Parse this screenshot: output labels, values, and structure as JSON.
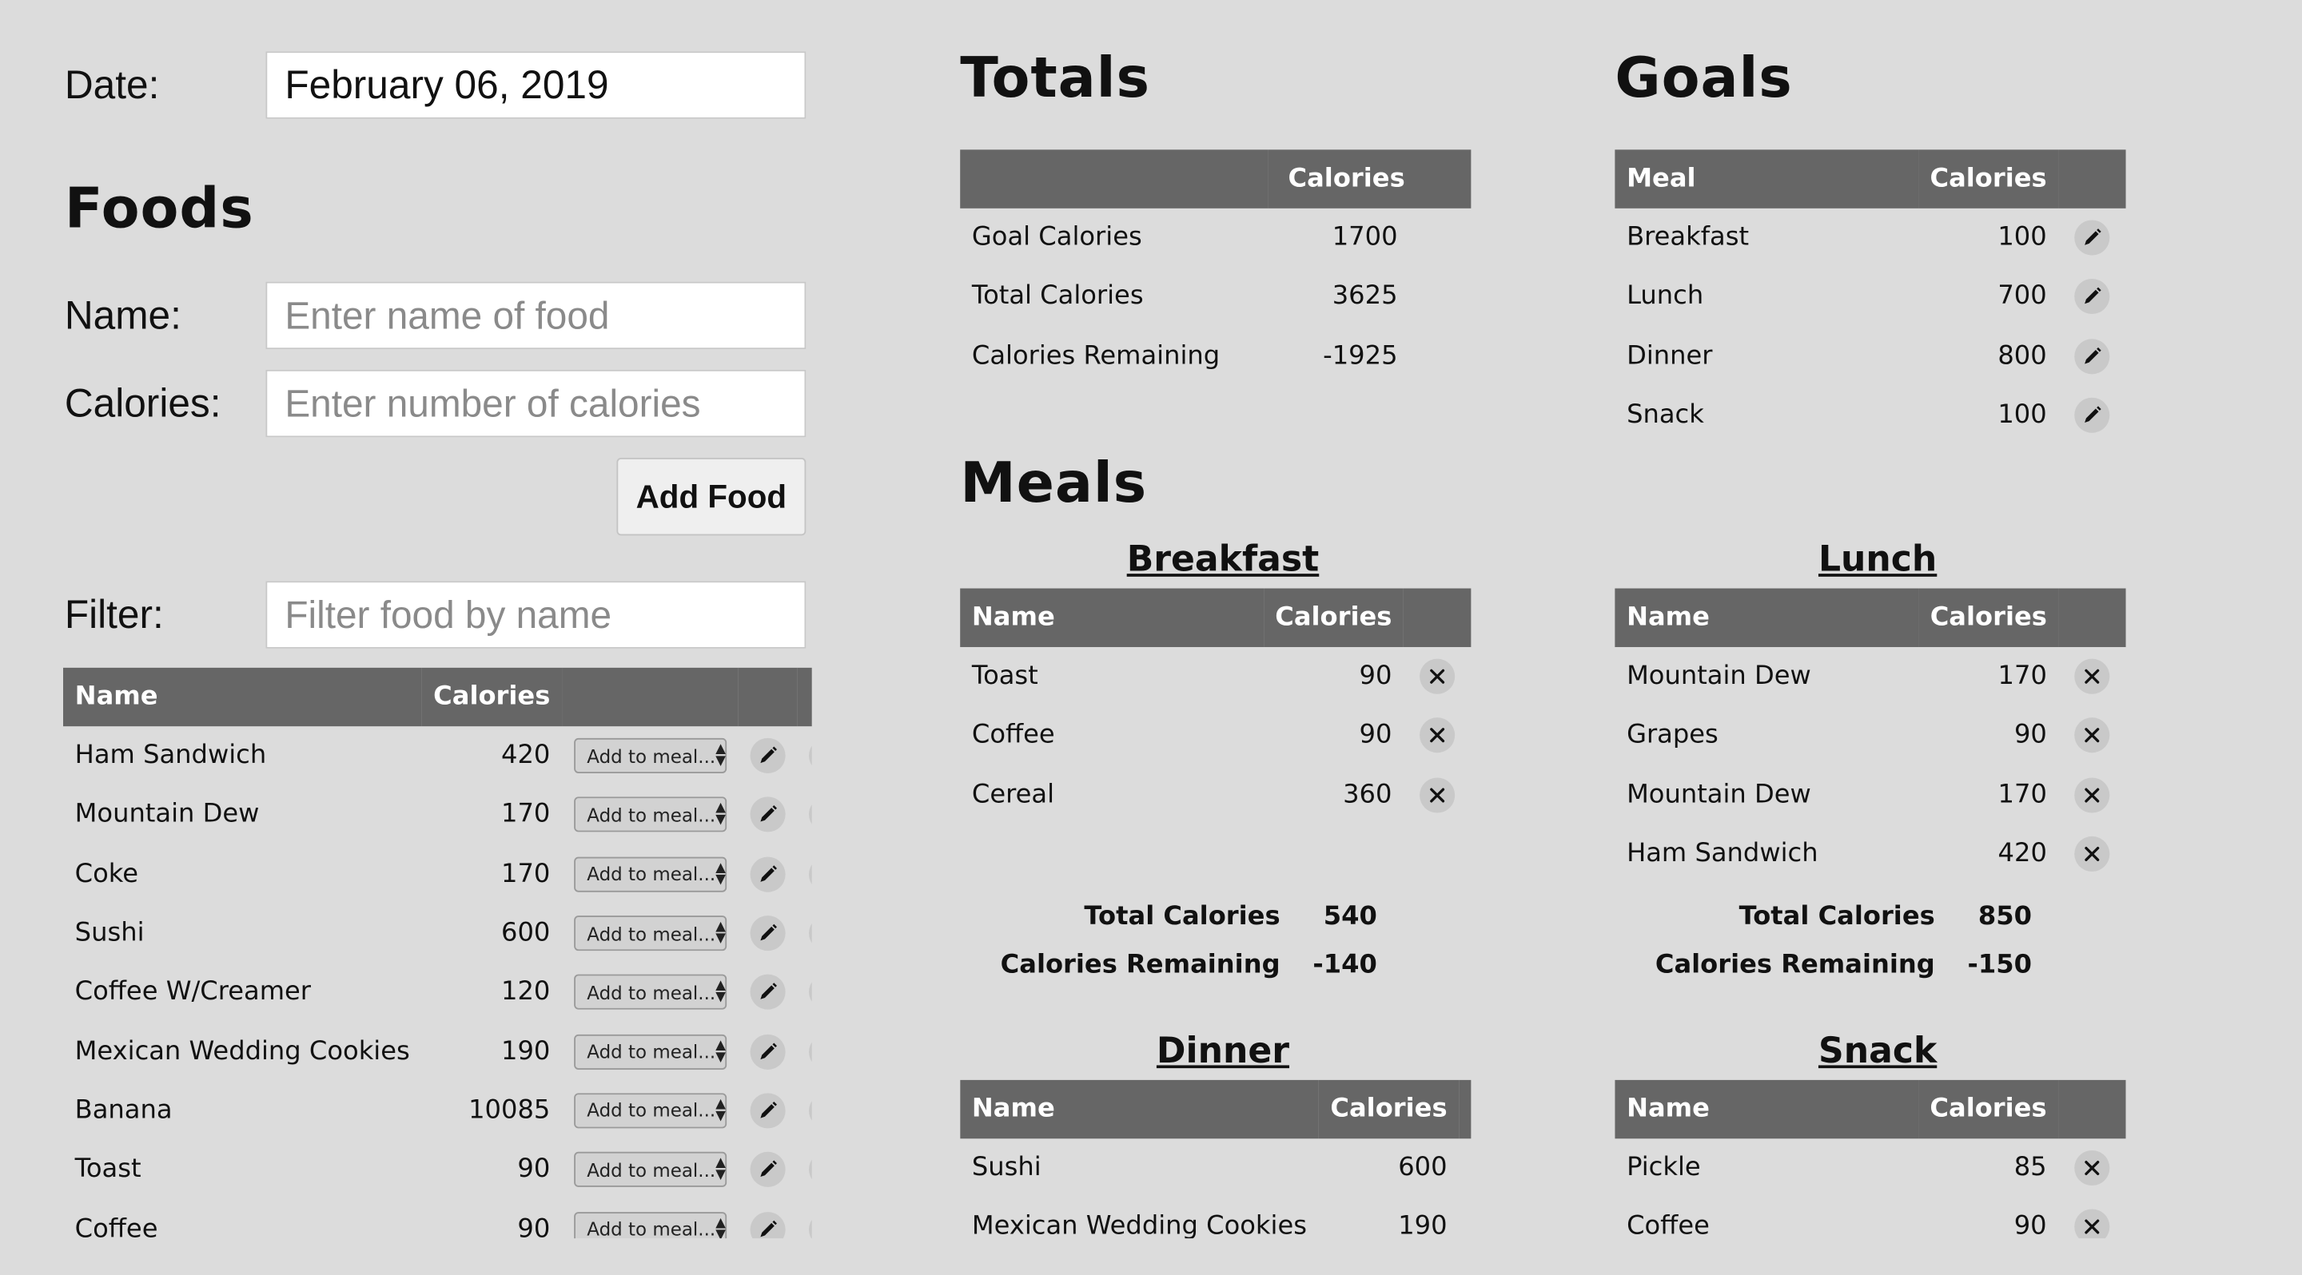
{
  "date": {
    "label": "Date:",
    "value": "February 06, 2019"
  },
  "foods": {
    "title": "Foods",
    "name_label": "Name:",
    "name_placeholder": "Enter name of food",
    "calories_label": "Calories:",
    "calories_placeholder": "Enter number of calories",
    "add_button": "Add Food",
    "filter_label": "Filter:",
    "filter_placeholder": "Filter food by name",
    "table": {
      "headers": [
        "Name",
        "Calories"
      ],
      "select_label": "Add to meal...",
      "rows": [
        {
          "name": "Ham Sandwich",
          "calories": "420"
        },
        {
          "name": "Mountain Dew",
          "calories": "170"
        },
        {
          "name": "Coke",
          "calories": "170"
        },
        {
          "name": "Sushi",
          "calories": "600"
        },
        {
          "name": "Coffee W/Creamer",
          "calories": "120"
        },
        {
          "name": "Mexican Wedding Cookies",
          "calories": "190"
        },
        {
          "name": "Banana",
          "calories": "10085"
        },
        {
          "name": "Toast",
          "calories": "90"
        },
        {
          "name": "Coffee",
          "calories": "90"
        }
      ]
    }
  },
  "totals": {
    "title": "Totals",
    "header_calories": "Calories",
    "rows": [
      {
        "label": "Goal Calories",
        "value": "1700"
      },
      {
        "label": "Total Calories",
        "value": "3625"
      },
      {
        "label": "Calories Remaining",
        "value": "-1925"
      }
    ]
  },
  "goals": {
    "title": "Goals",
    "headers": [
      "Meal",
      "Calories"
    ],
    "rows": [
      {
        "meal": "Breakfast",
        "calories": "100"
      },
      {
        "meal": "Lunch",
        "calories": "700"
      },
      {
        "meal": "Dinner",
        "calories": "800"
      },
      {
        "meal": "Snack",
        "calories": "100"
      }
    ]
  },
  "meals": {
    "title": "Meals",
    "headers": [
      "Name",
      "Calories"
    ],
    "total_label": "Total Calories",
    "remaining_label": "Calories Remaining",
    "breakfast": {
      "title": "Breakfast",
      "rows": [
        {
          "name": "Toast",
          "calories": "90"
        },
        {
          "name": "Coffee",
          "calories": "90"
        },
        {
          "name": "Cereal",
          "calories": "360"
        }
      ],
      "total": "540",
      "remaining": "-140"
    },
    "lunch": {
      "title": "Lunch",
      "rows": [
        {
          "name": "Mountain Dew",
          "calories": "170"
        },
        {
          "name": "Grapes",
          "calories": "90"
        },
        {
          "name": "Mountain Dew",
          "calories": "170"
        },
        {
          "name": "Ham Sandwich",
          "calories": "420"
        }
      ],
      "total": "850",
      "remaining": "-150"
    },
    "dinner": {
      "title": "Dinner",
      "rows": [
        {
          "name": "Sushi",
          "calories": "600"
        },
        {
          "name": "Mexican Wedding Cookies",
          "calories": "190"
        }
      ]
    },
    "snack": {
      "title": "Snack",
      "rows": [
        {
          "name": "Pickle",
          "calories": "85"
        },
        {
          "name": "Coffee",
          "calories": "90"
        }
      ]
    }
  }
}
